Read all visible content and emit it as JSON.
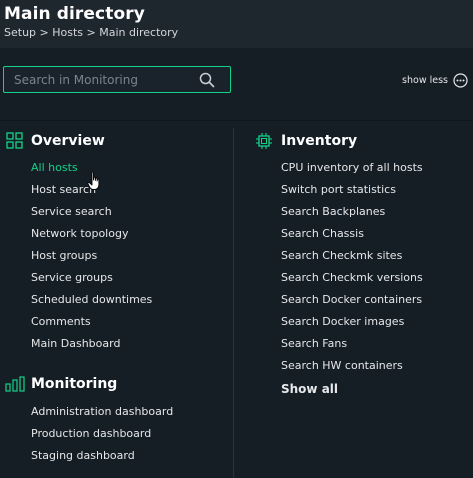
{
  "header": {
    "title": "Main directory",
    "breadcrumb": "Setup > Hosts > Main directory"
  },
  "search": {
    "placeholder": "Search in Monitoring",
    "value": ""
  },
  "toggle": {
    "label": "show less"
  },
  "colors": {
    "accent": "#13d389",
    "background": "#151d25",
    "header": "#1e262e"
  },
  "overview": {
    "title": "Overview",
    "icon": "grid-icon",
    "items": [
      {
        "label": "All hosts"
      },
      {
        "label": "Host search"
      },
      {
        "label": "Service search"
      },
      {
        "label": "Network topology"
      },
      {
        "label": "Host groups"
      },
      {
        "label": "Service groups"
      },
      {
        "label": "Scheduled downtimes"
      },
      {
        "label": "Comments"
      },
      {
        "label": "Main Dashboard"
      }
    ]
  },
  "monitoring": {
    "title": "Monitoring",
    "icon": "bars-icon",
    "items": [
      {
        "label": "Administration dashboard"
      },
      {
        "label": "Production dashboard"
      },
      {
        "label": "Staging dashboard"
      }
    ]
  },
  "inventory": {
    "title": "Inventory",
    "icon": "chip-icon",
    "items": [
      {
        "label": "CPU inventory of all hosts"
      },
      {
        "label": "Switch port statistics"
      },
      {
        "label": "Search Backplanes"
      },
      {
        "label": "Search Chassis"
      },
      {
        "label": "Search Checkmk sites"
      },
      {
        "label": "Search Checkmk versions"
      },
      {
        "label": "Search Docker containers"
      },
      {
        "label": "Search Docker images"
      },
      {
        "label": "Search Fans"
      },
      {
        "label": "Search HW containers"
      }
    ],
    "show_all": "Show all"
  }
}
